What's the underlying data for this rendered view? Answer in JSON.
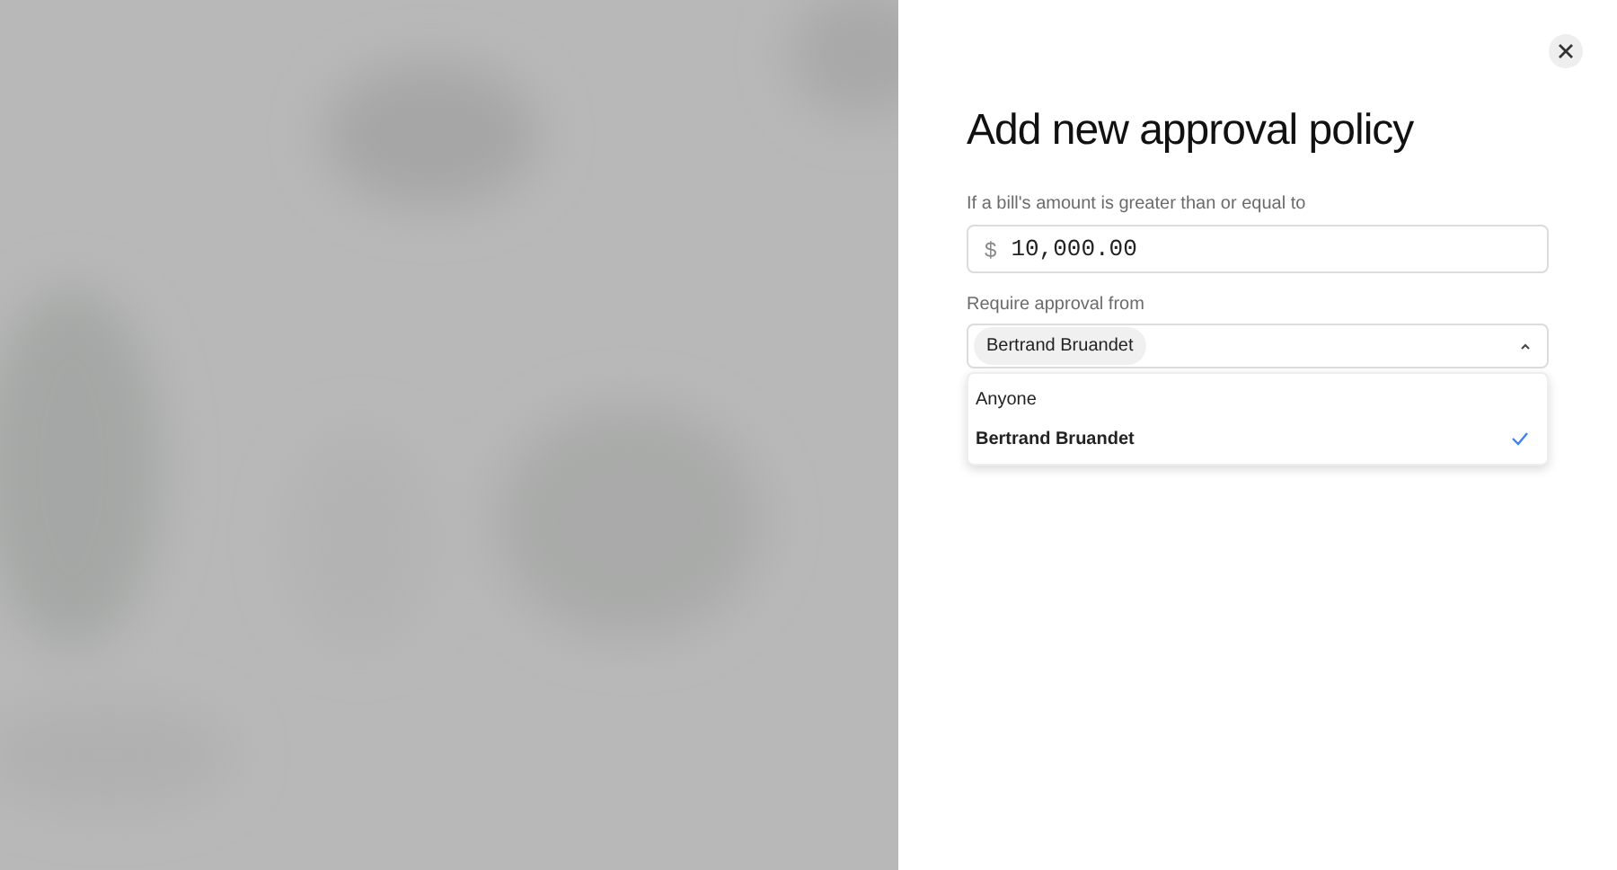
{
  "panel": {
    "title": "Add new approval policy",
    "amount_field": {
      "label": "If a bill's amount is greater than or equal to",
      "currency_symbol": "$",
      "value": "10,000.00"
    },
    "approver_field": {
      "label": "Require approval from",
      "chips": [
        "Bertrand Bruandet"
      ],
      "expanded": true,
      "options": [
        {
          "label": "Anyone",
          "selected": false
        },
        {
          "label": "Bertrand Bruandet",
          "selected": true
        }
      ]
    }
  }
}
